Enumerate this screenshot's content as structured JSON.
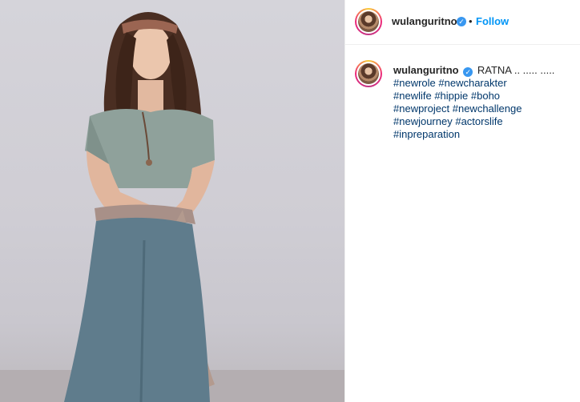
{
  "post": {
    "author": {
      "username": "wulanguritno",
      "verified_icon": "verified-badge-icon",
      "separator": "•",
      "follow_label": "Follow"
    },
    "caption": {
      "username": "wulanguritno",
      "text": "RATNA .. ..... .....",
      "hashtags": [
        "#newrole",
        "#newcharakter",
        "#newlife",
        "#hippie",
        "#boho",
        "#newproject",
        "#newchallenge",
        "#newjourney",
        "#actorslife",
        "#inpreparation"
      ]
    },
    "colors": {
      "follow": "#0095f6",
      "hashtag": "#00376b",
      "verified": "#3897f0"
    }
  }
}
